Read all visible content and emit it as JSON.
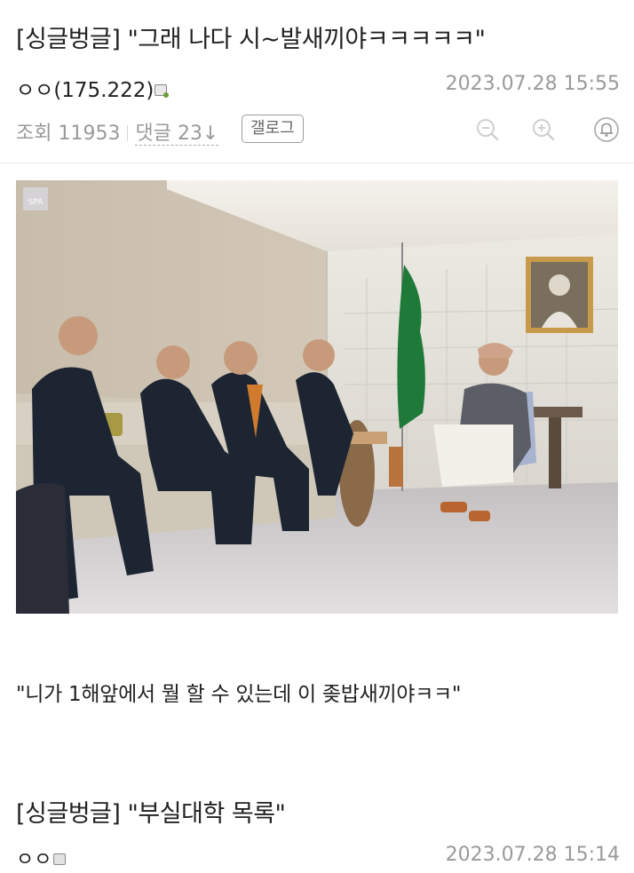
{
  "post": {
    "title": "[싱글벙글] \"그래 나다 시~발새끼야ㅋㅋㅋㅋㅋ\"",
    "author": "ㅇㅇ(175.222)",
    "date": "2023.07.28 15:55",
    "views_label": "조회 11953",
    "comments_label": "댓글 23↓",
    "gallery_button": "갤로그",
    "photo_badge": "SPA",
    "quote": "\"니가 1해앞에서 뭘 할 수 있는데 이 좆밥새끼야ㅋㅋ\""
  },
  "next_post": {
    "title": "[싱글벙글] \"부실대학 목록\"",
    "author": "ㅇㅇ",
    "date": "2023.07.28 15:14"
  },
  "icons": [
    "zoom-out-icon",
    "zoom-in-icon",
    "bell-icon",
    "member-badge-icon"
  ],
  "colors": {
    "text": "#222222",
    "muted": "#9a9a9a",
    "badge_dot": "#6a9d35"
  }
}
